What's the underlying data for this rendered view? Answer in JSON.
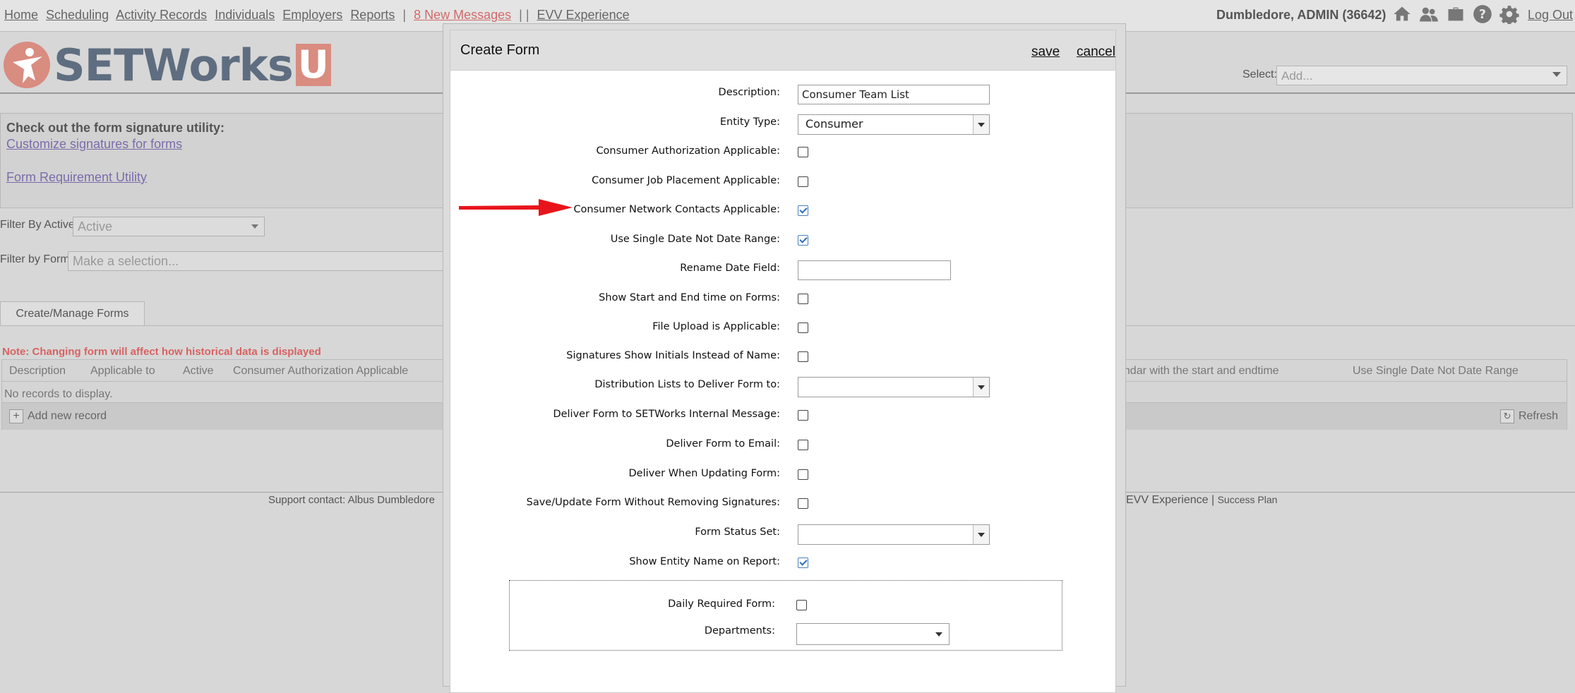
{
  "nav": {
    "items": [
      "Home",
      "Scheduling",
      "Activity Records",
      "Individuals",
      "Employers",
      "Reports"
    ],
    "sep1": "|",
    "messages": "8 New Messages",
    "sep2": "| |",
    "evv": "EVV Experience",
    "user": "Dumbledore, ADMIN  (36642)",
    "logout": "Log Out",
    "icons": [
      "home-icon",
      "people-icon",
      "briefcase-icon",
      "help-icon",
      "gear-icon"
    ]
  },
  "brand": {
    "name": "SETWorks",
    "u": "U",
    "accent": "#d98c80"
  },
  "header": {
    "select_label": "Select:",
    "select_placeholder": "Add..."
  },
  "info": {
    "title": "Check out the form signature utility:",
    "link1": "Customize signatures for forms",
    "link2": "Form Requirement Utility"
  },
  "filters": {
    "active_label": "Filter By Active:",
    "active_value": "Active",
    "form_label": "Filter by Form:",
    "form_placeholder": "Make a selection..."
  },
  "tabs": {
    "manage": "Create/Manage Forms"
  },
  "grid": {
    "note": "Note: Changing form will affect how historical data is displayed",
    "columns": [
      "Description",
      "Applicable to",
      "Active",
      "Consumer Authorization Applicable",
      "endar with the start and endtime",
      "Use Single Date Not Date Range"
    ],
    "empty": "No records to display.",
    "add": "Add new record",
    "refresh": "Refresh"
  },
  "footer": {
    "support": "Support contact: Albus Dumbledore",
    "evv": "EVV Experience",
    "sep": "|",
    "success": "Success Plan"
  },
  "modal": {
    "title": "Create Form",
    "save": "save",
    "cancel": "cancel",
    "fields": [
      {
        "label": "Description:",
        "type": "text",
        "value": "Consumer Team List"
      },
      {
        "label": "Entity Type:",
        "type": "select",
        "value": "Consumer"
      },
      {
        "label": "Consumer Authorization Applicable:",
        "type": "checkbox",
        "checked": false
      },
      {
        "label": "Consumer Job Placement Applicable:",
        "type": "checkbox",
        "checked": false
      },
      {
        "label": "Consumer Network Contacts Applicable:",
        "type": "checkbox",
        "checked": true
      },
      {
        "label": "Use Single Date Not Date Range:",
        "type": "checkbox",
        "checked": true
      },
      {
        "label": "Rename Date Field:",
        "type": "text",
        "value": ""
      },
      {
        "label": "Show Start and End time on Forms:",
        "type": "checkbox",
        "checked": false
      },
      {
        "label": "File Upload is Applicable:",
        "type": "checkbox",
        "checked": false
      },
      {
        "label": "Signatures Show Initials Instead of Name:",
        "type": "checkbox",
        "checked": false
      },
      {
        "label": "Distribution Lists to Deliver Form to:",
        "type": "select",
        "value": ""
      },
      {
        "label": "Deliver Form to SETWorks Internal Message:",
        "type": "checkbox",
        "checked": false
      },
      {
        "label": "Deliver Form to Email:",
        "type": "checkbox",
        "checked": false
      },
      {
        "label": "Deliver When Updating Form:",
        "type": "checkbox",
        "checked": false
      },
      {
        "label": "Save/Update Form Without Removing Signatures:",
        "type": "checkbox",
        "checked": false
      },
      {
        "label": "Form Status Set:",
        "type": "select",
        "value": ""
      },
      {
        "label": "Show Entity Name on Report:",
        "type": "checkbox",
        "checked": true
      }
    ],
    "daily": {
      "label": "Daily Required Form:",
      "checked": false
    },
    "departments": {
      "label": "Departments:",
      "value": ""
    }
  },
  "colors": {
    "arrow": "#e8141b",
    "check": "#2d6cc0",
    "message": "#d16a6a"
  }
}
